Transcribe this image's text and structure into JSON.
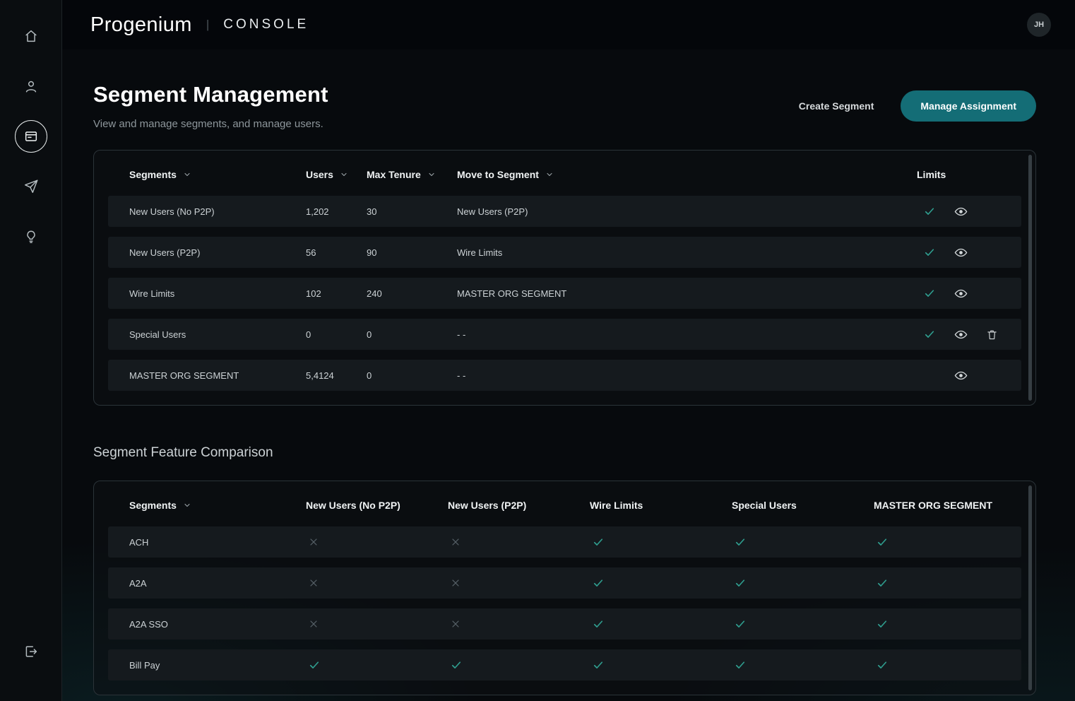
{
  "topbar": {
    "brand": "Progenium",
    "divider": "|",
    "product": "CONSOLE",
    "avatar_initials": "JH"
  },
  "sidebar": {
    "items": [
      {
        "id": "home"
      },
      {
        "id": "users"
      },
      {
        "id": "segments",
        "active": true
      },
      {
        "id": "send"
      },
      {
        "id": "insights"
      },
      {
        "id": "logout"
      }
    ]
  },
  "page": {
    "title": "Segment Management",
    "subtitle": "View and manage segments, and manage users.",
    "create_label": "Create Segment",
    "manage_label": "Manage Assignment"
  },
  "colors": {
    "accent": "#146d76",
    "check": "#2f9e8f",
    "cross": "#59646a"
  },
  "segments_table": {
    "columns": [
      {
        "label": "Segments",
        "sortable": true
      },
      {
        "label": "Users",
        "sortable": true
      },
      {
        "label": "Max Tenure",
        "sortable": true
      },
      {
        "label": "Move to Segment",
        "sortable": true
      },
      {
        "label": "Limits",
        "sortable": false
      }
    ],
    "rows": [
      {
        "name": "New Users (No P2P)",
        "users": "1,202",
        "max_tenure": "30",
        "move_to": "New Users (P2P)",
        "limit_check": true,
        "actions": [
          "view"
        ]
      },
      {
        "name": "New Users (P2P)",
        "users": "56",
        "max_tenure": "90",
        "move_to": "Wire Limits",
        "limit_check": true,
        "actions": [
          "view"
        ]
      },
      {
        "name": "Wire Limits",
        "users": "102",
        "max_tenure": "240",
        "move_to": "MASTER ORG SEGMENT",
        "limit_check": true,
        "actions": [
          "view"
        ]
      },
      {
        "name": "Special Users",
        "users": "0",
        "max_tenure": "0",
        "move_to": "- -",
        "limit_check": true,
        "actions": [
          "view",
          "delete"
        ]
      },
      {
        "name": "MASTER ORG SEGMENT",
        "users": "5,4124",
        "max_tenure": "0",
        "move_to": "- -",
        "limit_check": false,
        "actions": [
          "view"
        ]
      }
    ]
  },
  "comparison": {
    "section_title": "Segment Feature Comparison",
    "columns": [
      {
        "label": "Segments",
        "sortable": true
      },
      {
        "label": "New Users (No P2P)"
      },
      {
        "label": "New Users (P2P)"
      },
      {
        "label": "Wire Limits"
      },
      {
        "label": "Special Users"
      },
      {
        "label": "MASTER ORG SEGMENT"
      }
    ],
    "rows": [
      {
        "feature": "ACH",
        "values": [
          false,
          false,
          true,
          true,
          true
        ]
      },
      {
        "feature": "A2A",
        "values": [
          false,
          false,
          true,
          true,
          true
        ]
      },
      {
        "feature": "A2A SSO",
        "values": [
          false,
          false,
          true,
          true,
          true
        ]
      },
      {
        "feature": "Bill Pay",
        "values": [
          true,
          true,
          true,
          true,
          true
        ]
      }
    ]
  }
}
